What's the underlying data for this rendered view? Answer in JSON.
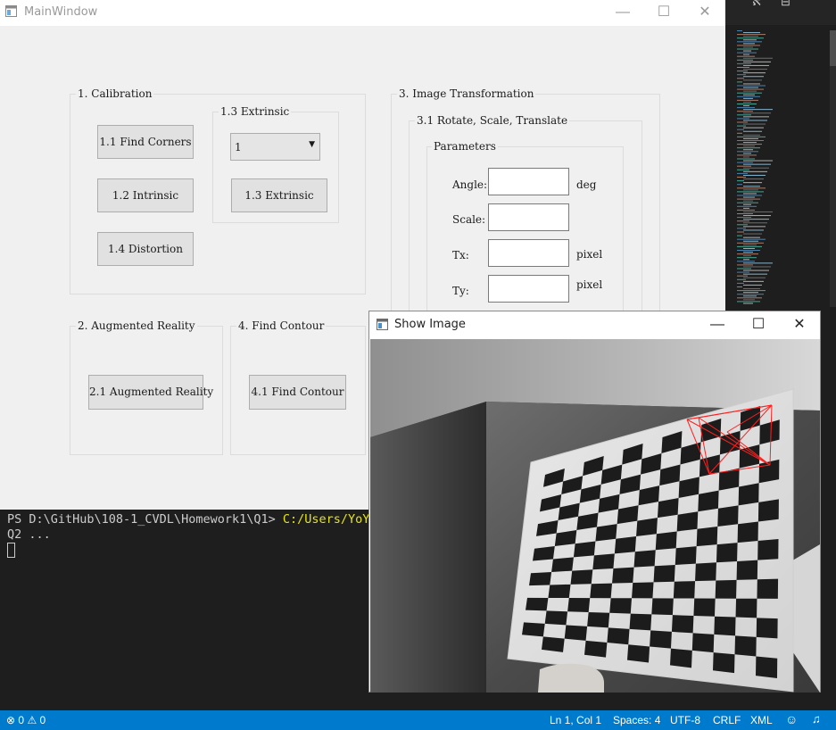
{
  "main_window": {
    "title": "MainWindow",
    "controls": {
      "minimize": "—",
      "maximize": "☐",
      "close": "✕"
    },
    "calibration": {
      "title": "1. Calibration",
      "find_corners": "1.1 Find Corners",
      "intrinsic": "1.2 Intrinsic",
      "distortion": "1.4 Distortion",
      "extrinsic_group": {
        "title": "1.3 Extrinsic",
        "selected": "1",
        "button": "1.3 Extrinsic"
      }
    },
    "augmented_reality": {
      "title": "2. Augmented Reality",
      "button": "2.1 Augmented Reality"
    },
    "find_contour": {
      "title": "4. Find Contour",
      "button": "4.1 Find Contour"
    },
    "image_transformation": {
      "title": "3. Image Transformation",
      "sub_title": "3.1 Rotate, Scale, Translate",
      "parameters_title": "Parameters",
      "angle_label": "Angle:",
      "angle_unit": "deg",
      "angle_value": "",
      "scale_label": "Scale:",
      "scale_value": "",
      "tx_label": "Tx:",
      "tx_unit": "pixel",
      "tx_value": "",
      "ty_label": "Ty:",
      "ty_unit": "pixel",
      "ty_value": ""
    }
  },
  "show_window": {
    "title": "Show Image",
    "controls": {
      "minimize": "—",
      "maximize": "☐",
      "close": "✕"
    }
  },
  "terminal": {
    "prompt": "PS D:\\GitHub\\108-1_CVDL\\Homework1\\Q1> ",
    "command": "C:/Users/YoYo/.conda",
    "output": "Q2 ..."
  },
  "statusbar": {
    "errors": "0",
    "warnings": "0",
    "position": "Ln 1, Col 1",
    "spaces": "Spaces: 4",
    "encoding": "UTF-8",
    "eol": "CRLF",
    "language": "XML"
  },
  "colors": {
    "statusbar_bg": "#007acc",
    "terminal_bg": "#1e1e1e",
    "terminal_path": "#e5e510",
    "overlay_lines": "#ff2020"
  }
}
